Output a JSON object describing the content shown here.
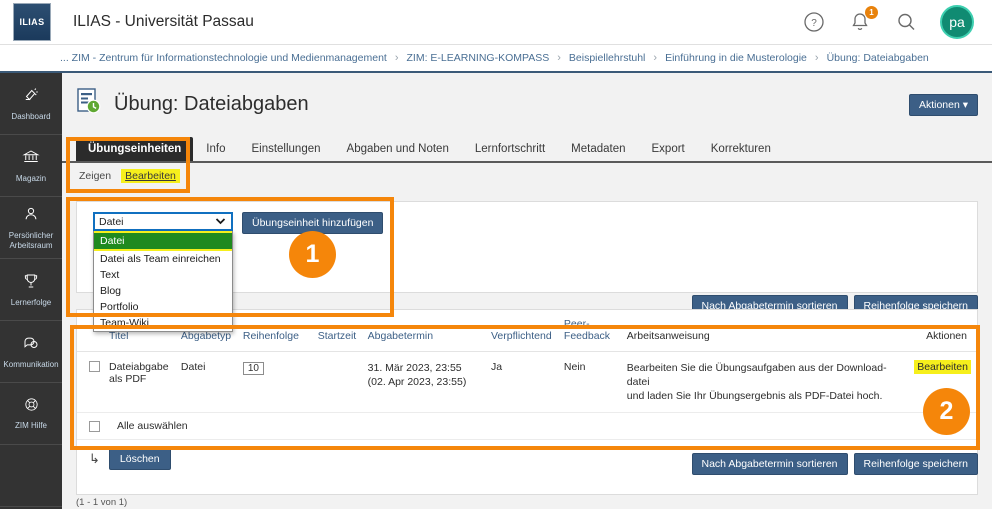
{
  "header": {
    "logo_text": "ILIAS",
    "app_title": "ILIAS - Universität Passau",
    "icons": [
      {
        "name": "help-icon",
        "glyph": "?"
      },
      {
        "name": "notifications-icon",
        "glyph": "bell",
        "badge": "1"
      },
      {
        "name": "search-icon",
        "glyph": "magnifier"
      }
    ],
    "avatar_initials": "pa"
  },
  "breadcrumb": {
    "items": [
      "... ZIM - Zentrum für Informationstechnologie und Medienmanagement",
      "ZIM: E-LEARNING-KOMPASS",
      "Beispiellehrstuhl",
      "Einführung in die Musterologie",
      "Übung: Dateiabgaben"
    ],
    "separator": "›"
  },
  "sidebar": {
    "items": [
      {
        "label": "Dashboard",
        "icon": "dashboard-icon"
      },
      {
        "label": "Magazin",
        "icon": "bank-icon"
      },
      {
        "label": "Persönlicher Arbeitsraum",
        "icon": "person-icon"
      },
      {
        "label": "Lernerfolge",
        "icon": "trophy-icon"
      },
      {
        "label": "Kommunikation",
        "icon": "chat-icon"
      },
      {
        "label": "ZIM Hilfe",
        "icon": "lifebuoy-icon"
      }
    ]
  },
  "page": {
    "title": "Übung: Dateiabgaben",
    "title_icon": "exercise-clock-icon",
    "actions_button": "Aktionen ▾"
  },
  "tabs": {
    "items": [
      {
        "label": "Übungseinheiten",
        "active": true
      },
      {
        "label": "Info",
        "active": false
      },
      {
        "label": "Einstellungen",
        "active": false
      },
      {
        "label": "Abgaben und Noten",
        "active": false
      },
      {
        "label": "Lernfortschritt",
        "active": false
      },
      {
        "label": "Metadaten",
        "active": false
      },
      {
        "label": "Export",
        "active": false
      },
      {
        "label": "Korrekturen",
        "active": false
      }
    ],
    "subtabs": [
      {
        "label": "Zeigen",
        "highlighted": false
      },
      {
        "label": "Bearbeiten",
        "highlighted": true
      }
    ]
  },
  "add_unit": {
    "select_value": "Datei",
    "chevron": "⌄",
    "options": [
      "Datei",
      "Datei als Team einreichen",
      "Text",
      "Blog",
      "Portfolio",
      "Team-Wiki"
    ],
    "selected_option_index": 0,
    "add_button": "Übungseinheit hinzufügen",
    "behind_label": "Übungseinheiten",
    "behind_count": "(1 - 1 von 1)"
  },
  "sort_buttons": {
    "sort_by_deadline": "Nach Abgabetermin sortieren",
    "save_order": "Reihenfolge speichern"
  },
  "table": {
    "headers": [
      "Titel",
      "Abgabetyp",
      "Reihenfolge",
      "Startzeit",
      "Abgabetermin",
      "Verpflichtend",
      "Peer-Feedback",
      "Arbeitsanweisung",
      "Aktionen"
    ],
    "peer_header_line1": "Peer-",
    "peer_header_line2": "Feedback",
    "rows": [
      {
        "titel": "Dateiabgabe als PDF",
        "abgabetyp": "Datei",
        "reihenfolge": "10",
        "startzeit": "",
        "abgabetermin_line1": "31. Mär 2023, 23:55",
        "abgabetermin_line2": "(02. Apr 2023, 23:55)",
        "verpflichtend": "Ja",
        "peer_feedback": "Nein",
        "arbeitsanweisung_line1": "Bearbeiten Sie die Übungsaufgaben aus der Download-datei",
        "arbeitsanweisung_line2": "und laden Sie Ihr Übungsergebnis als PDF-Datei hoch.",
        "aktion": "Bearbeiten"
      }
    ],
    "select_all_label": "Alle auswählen",
    "delete_button": "Löschen",
    "pagination": "(1 - 1 von 1)"
  },
  "annotations": {
    "badge1": "1",
    "badge2": "2",
    "accent_color": "#f5860a",
    "highlight_color": "#f6ef1c"
  }
}
